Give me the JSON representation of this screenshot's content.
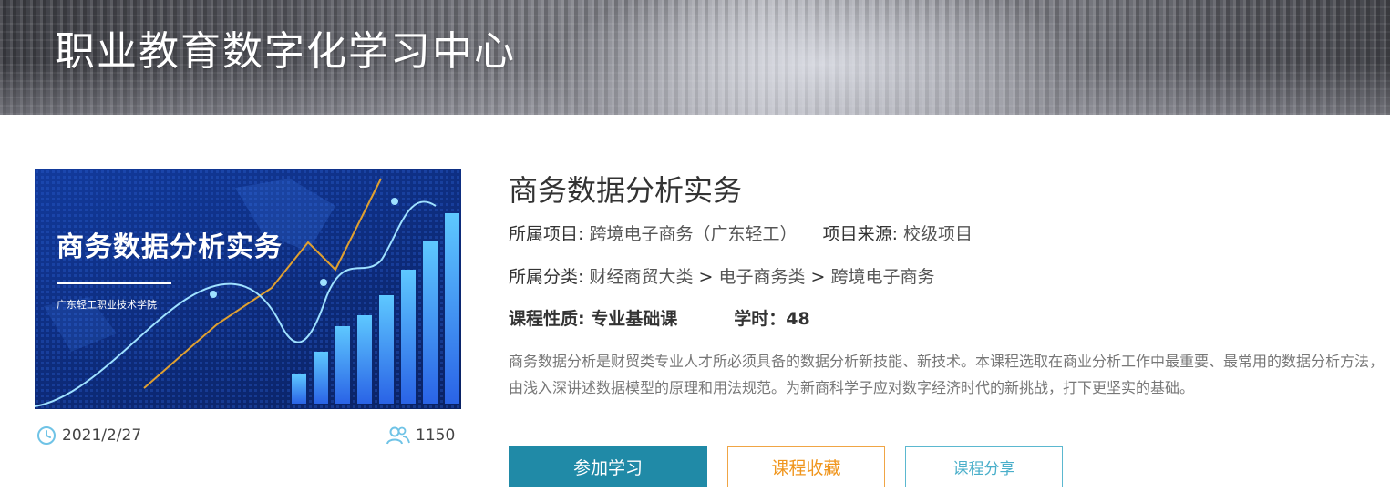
{
  "banner": {
    "title": "职业教育数字化学习中心"
  },
  "cover": {
    "title": "商务数据分析实务",
    "school": "广东轻工职业技术学院"
  },
  "meta": {
    "date": "2021/2/27",
    "learners": "1150"
  },
  "course": {
    "title": "商务数据分析实务",
    "project_label": "所属项目: ",
    "project_value": "跨境电子商务（广东轻工）",
    "source_label": "项目来源: ",
    "source_value": "校级项目",
    "category_label": "所属分类: ",
    "category_path": [
      "财经商贸大类",
      "电子商务类",
      "跨境电子商务"
    ],
    "category_separator": " > ",
    "nature_label": "课程性质: ",
    "nature_value": "专业基础课",
    "hours_label": "学时：",
    "hours_value": "48",
    "description": "商务数据分析是财贸类专业人才所必须具备的数据分析新技能、新技术。本课程选取在商业分析工作中最重要、最常用的数据分析方法，由浅入深讲述数据模型的原理和用法规范。为新商科学子应对数字经济时代的新挑战，打下更坚实的基础。"
  },
  "actions": {
    "join": "参加学习",
    "favorite": "课程收藏",
    "share": "课程分享"
  },
  "icons": {
    "date": "clock-icon",
    "learners": "users-icon"
  },
  "colors": {
    "primary": "#208aa7",
    "favorite": "#f0961e",
    "share": "#4aafca"
  }
}
